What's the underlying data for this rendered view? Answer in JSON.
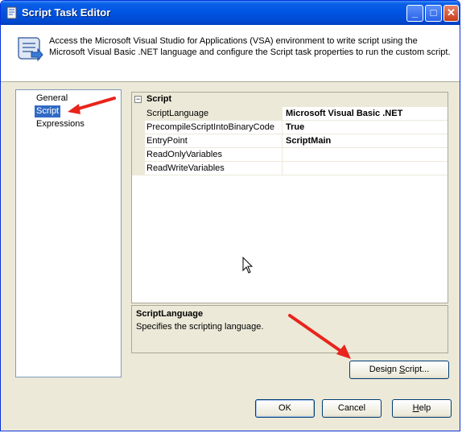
{
  "window": {
    "title": "Script Task Editor"
  },
  "titlebar_buttons": {
    "minimize": "_",
    "maximize": "□",
    "close": "✕"
  },
  "header": {
    "description": "Access the Microsoft Visual Studio for Applications (VSA) environment to write script using the Microsoft Visual Basic .NET language and configure the Script task properties to run the custom script."
  },
  "nav": {
    "items": [
      {
        "label": "General"
      },
      {
        "label": "Script",
        "selected": true
      },
      {
        "label": "Expressions"
      }
    ]
  },
  "grid": {
    "category": "Script",
    "toggle": "−",
    "properties": [
      {
        "name": "ScriptLanguage",
        "value": "Microsoft Visual Basic .NET"
      },
      {
        "name": "PrecompileScriptIntoBinaryCode",
        "value": "True"
      },
      {
        "name": "EntryPoint",
        "value": "ScriptMain"
      },
      {
        "name": "ReadOnlyVariables",
        "value": ""
      },
      {
        "name": "ReadWriteVariables",
        "value": ""
      }
    ]
  },
  "description_panel": {
    "title": "ScriptLanguage",
    "text": "Specifies the scripting language."
  },
  "buttons": {
    "design_script": {
      "before": "Design ",
      "underlined": "S",
      "after": "cript..."
    },
    "ok": "OK",
    "cancel": "Cancel",
    "help": {
      "underlined": "H",
      "after": "elp"
    }
  },
  "colors": {
    "titlebar": "#0054e3",
    "selection": "#316ac5",
    "annotation_arrow": "#e8241c",
    "dialog_bg": "#ece9d8"
  },
  "icons": {
    "title": "script-task-icon",
    "header": "script-scroll-icon"
  }
}
